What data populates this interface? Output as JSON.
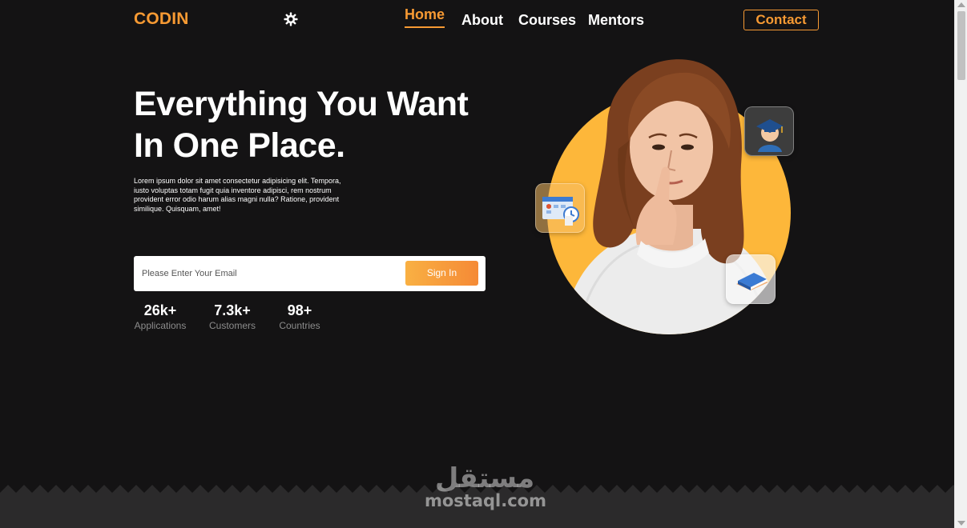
{
  "header": {
    "logo": "CODIN",
    "theme_toggle_icon": "gear-icon",
    "nav": {
      "home": "Home",
      "about": "About",
      "courses": "Courses",
      "mentors": "Mentors"
    },
    "active_nav": "Home",
    "contact_label": "Contact"
  },
  "hero": {
    "title_line1": "Everything You Want",
    "title_line2": "In One Place.",
    "description": "Lorem ipsum dolor sit amet consectetur adipisicing elit. Tempora, iusto voluptas totam fugit quia inventore adipisci, rem nostrum provident error odio harum alias magni nulla? Ratione, provident similique. Quisquam, amet!",
    "email_placeholder": "Please Enter Your Email",
    "signin_label": "Sign In"
  },
  "stats": [
    {
      "value": "26k+",
      "label": "Applications"
    },
    {
      "value": "7.3k+",
      "label": "Customers"
    },
    {
      "value": "98+",
      "label": "Countries"
    }
  ],
  "illustration": {
    "badges": [
      "graduate-icon",
      "calendar-icon",
      "book-icon"
    ]
  },
  "watermark": {
    "arabic": "مستقل",
    "latin": "mostaql.com"
  },
  "colors": {
    "accent": "#f79a33",
    "background": "#141314",
    "circle": "#fdb73a",
    "muted_text": "#8c8c8c"
  }
}
